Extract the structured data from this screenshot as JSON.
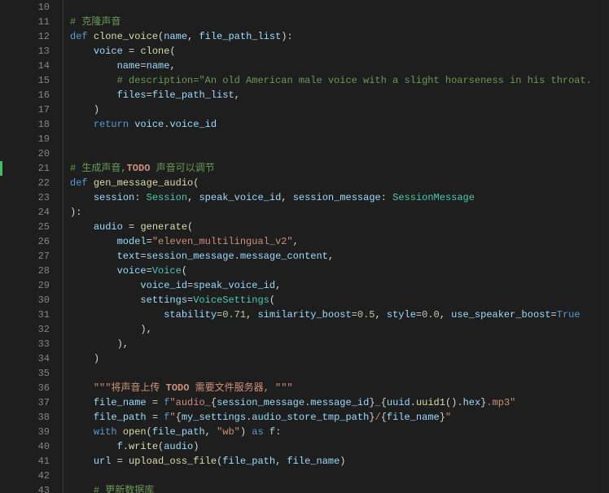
{
  "editor": {
    "first_line_number": 10,
    "diff_marker_line": 21,
    "lines": [
      [],
      [
        [
          "cmt",
          "# 克隆声音"
        ]
      ],
      [
        [
          "kw",
          "def"
        ],
        [
          "punct",
          " "
        ],
        [
          "fn",
          "clone_voice"
        ],
        [
          "punct",
          "("
        ],
        [
          "id",
          "name"
        ],
        [
          "punct",
          ", "
        ],
        [
          "id",
          "file_path_list"
        ],
        [
          "punct",
          "):"
        ]
      ],
      [
        [
          "punct",
          "    "
        ],
        [
          "id",
          "voice"
        ],
        [
          "punct",
          " = "
        ],
        [
          "fn",
          "clone"
        ],
        [
          "punct",
          "("
        ]
      ],
      [
        [
          "punct",
          "        "
        ],
        [
          "id",
          "name"
        ],
        [
          "punct",
          "="
        ],
        [
          "id",
          "name"
        ],
        [
          "punct",
          ","
        ]
      ],
      [
        [
          "punct",
          "        "
        ],
        [
          "cmt",
          "# description=\"An old American male voice with a slight hoarseness in his throat."
        ]
      ],
      [
        [
          "punct",
          "        "
        ],
        [
          "id",
          "files"
        ],
        [
          "punct",
          "="
        ],
        [
          "id",
          "file_path_list"
        ],
        [
          "punct",
          ","
        ]
      ],
      [
        [
          "punct",
          "    "
        ],
        [
          "punct",
          ")"
        ]
      ],
      [
        [
          "punct",
          "    "
        ],
        [
          "kw",
          "return"
        ],
        [
          "punct",
          " "
        ],
        [
          "id",
          "voice"
        ],
        [
          "punct",
          "."
        ],
        [
          "id",
          "voice_id"
        ]
      ],
      [],
      [],
      [
        [
          "cmt",
          "# 生成声音,"
        ],
        [
          "todo",
          "TODO"
        ],
        [
          "cmt",
          " 声音可以调节"
        ]
      ],
      [
        [
          "kw",
          "def"
        ],
        [
          "punct",
          " "
        ],
        [
          "fn",
          "gen_message_audio"
        ],
        [
          "punct",
          "("
        ]
      ],
      [
        [
          "punct",
          "    "
        ],
        [
          "id",
          "session"
        ],
        [
          "punct",
          ": "
        ],
        [
          "type",
          "Session"
        ],
        [
          "punct",
          ", "
        ],
        [
          "id",
          "speak_voice_id"
        ],
        [
          "punct",
          ", "
        ],
        [
          "id",
          "session_message"
        ],
        [
          "punct",
          ": "
        ],
        [
          "type",
          "SessionMessage"
        ]
      ],
      [
        [
          "punct",
          "):"
        ]
      ],
      [
        [
          "punct",
          "    "
        ],
        [
          "id",
          "audio"
        ],
        [
          "punct",
          " = "
        ],
        [
          "fn",
          "generate"
        ],
        [
          "punct",
          "("
        ]
      ],
      [
        [
          "punct",
          "        "
        ],
        [
          "id",
          "model"
        ],
        [
          "punct",
          "="
        ],
        [
          "str",
          "\"eleven_multilingual_v2\""
        ],
        [
          "punct",
          ","
        ]
      ],
      [
        [
          "punct",
          "        "
        ],
        [
          "id",
          "text"
        ],
        [
          "punct",
          "="
        ],
        [
          "id",
          "session_message"
        ],
        [
          "punct",
          "."
        ],
        [
          "id",
          "message_content"
        ],
        [
          "punct",
          ","
        ]
      ],
      [
        [
          "punct",
          "        "
        ],
        [
          "id",
          "voice"
        ],
        [
          "punct",
          "="
        ],
        [
          "type",
          "Voice"
        ],
        [
          "punct",
          "("
        ]
      ],
      [
        [
          "punct",
          "            "
        ],
        [
          "id",
          "voice_id"
        ],
        [
          "punct",
          "="
        ],
        [
          "id",
          "speak_voice_id"
        ],
        [
          "punct",
          ","
        ]
      ],
      [
        [
          "punct",
          "            "
        ],
        [
          "id",
          "settings"
        ],
        [
          "punct",
          "="
        ],
        [
          "type",
          "VoiceSettings"
        ],
        [
          "punct",
          "("
        ]
      ],
      [
        [
          "punct",
          "                "
        ],
        [
          "id",
          "stability"
        ],
        [
          "punct",
          "="
        ],
        [
          "num",
          "0.71"
        ],
        [
          "punct",
          ", "
        ],
        [
          "id",
          "similarity_boost"
        ],
        [
          "punct",
          "="
        ],
        [
          "num",
          "0.5"
        ],
        [
          "punct",
          ", "
        ],
        [
          "id",
          "style"
        ],
        [
          "punct",
          "="
        ],
        [
          "num",
          "0.0"
        ],
        [
          "punct",
          ", "
        ],
        [
          "id",
          "use_speaker_boost"
        ],
        [
          "punct",
          "="
        ],
        [
          "const",
          "True"
        ]
      ],
      [
        [
          "punct",
          "            "
        ],
        [
          "punct",
          "),"
        ]
      ],
      [
        [
          "punct",
          "        "
        ],
        [
          "punct",
          "),"
        ]
      ],
      [
        [
          "punct",
          "    "
        ],
        [
          "punct",
          ")"
        ]
      ],
      [],
      [
        [
          "punct",
          "    "
        ],
        [
          "str",
          "\"\"\"将声音上传 "
        ],
        [
          "todo",
          "TODO"
        ],
        [
          "str",
          " 需要文件服务器, \"\"\""
        ]
      ],
      [
        [
          "punct",
          "    "
        ],
        [
          "id",
          "file_name"
        ],
        [
          "punct",
          " = "
        ],
        [
          "kw",
          "f"
        ],
        [
          "str",
          "\"audio_"
        ],
        [
          "punct",
          "{"
        ],
        [
          "id",
          "session_message"
        ],
        [
          "punct",
          "."
        ],
        [
          "id",
          "message_id"
        ],
        [
          "punct",
          "}"
        ],
        [
          "str",
          "_"
        ],
        [
          "punct",
          "{"
        ],
        [
          "id",
          "uuid"
        ],
        [
          "punct",
          "."
        ],
        [
          "fn",
          "uuid1"
        ],
        [
          "punct",
          "()."
        ],
        [
          "id",
          "hex"
        ],
        [
          "punct",
          "}"
        ],
        [
          "str",
          ".mp3\""
        ]
      ],
      [
        [
          "punct",
          "    "
        ],
        [
          "id",
          "file_path"
        ],
        [
          "punct",
          " = "
        ],
        [
          "kw",
          "f"
        ],
        [
          "str",
          "\""
        ],
        [
          "punct",
          "{"
        ],
        [
          "id",
          "my_settings"
        ],
        [
          "punct",
          "."
        ],
        [
          "id",
          "audio_store_tmp_path"
        ],
        [
          "punct",
          "}"
        ],
        [
          "str",
          "/"
        ],
        [
          "punct",
          "{"
        ],
        [
          "id",
          "file_name"
        ],
        [
          "punct",
          "}"
        ],
        [
          "str",
          "\""
        ]
      ],
      [
        [
          "punct",
          "    "
        ],
        [
          "kw",
          "with"
        ],
        [
          "punct",
          " "
        ],
        [
          "fn",
          "open"
        ],
        [
          "punct",
          "("
        ],
        [
          "id",
          "file_path"
        ],
        [
          "punct",
          ", "
        ],
        [
          "str",
          "\"wb\""
        ],
        [
          "punct",
          ") "
        ],
        [
          "kw",
          "as"
        ],
        [
          "punct",
          " "
        ],
        [
          "id",
          "f"
        ],
        [
          "punct",
          ":"
        ]
      ],
      [
        [
          "punct",
          "        "
        ],
        [
          "id",
          "f"
        ],
        [
          "punct",
          "."
        ],
        [
          "fn",
          "write"
        ],
        [
          "punct",
          "("
        ],
        [
          "id",
          "audio"
        ],
        [
          "punct",
          ")"
        ]
      ],
      [
        [
          "punct",
          "    "
        ],
        [
          "id",
          "url"
        ],
        [
          "punct",
          " = "
        ],
        [
          "fn",
          "upload_oss_file"
        ],
        [
          "punct",
          "("
        ],
        [
          "id",
          "file_path"
        ],
        [
          "punct",
          ", "
        ],
        [
          "id",
          "file_name"
        ],
        [
          "punct",
          ")"
        ]
      ],
      [],
      [
        [
          "punct",
          "    "
        ],
        [
          "cmt",
          "# 更新数据库"
        ]
      ]
    ]
  }
}
